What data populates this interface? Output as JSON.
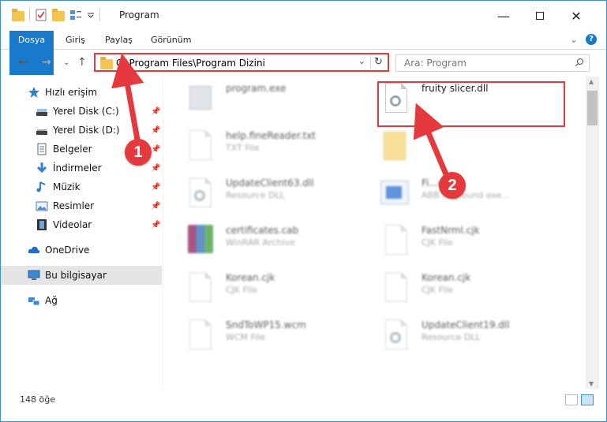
{
  "window": {
    "title": "Program",
    "minimize_glyph": "—",
    "close_glyph": "✕"
  },
  "ribbon": {
    "tabs": [
      "Dosya",
      "Giriş",
      "Paylaş",
      "Görünüm"
    ],
    "collapse_glyph": "⌄",
    "help_glyph": "?"
  },
  "nav": {
    "back_glyph": "←",
    "forward_glyph": "→",
    "recent_glyph": "⌄",
    "up_glyph": "↑",
    "address": "C:\\Program Files\\Program Dizini",
    "address_dropdown_glyph": "⌄",
    "refresh_glyph": "↻",
    "search_placeholder": "Ara: Program"
  },
  "sidebar": {
    "items": [
      {
        "label": "Hızlı erişim",
        "icon": "star-icon",
        "pinned": false
      },
      {
        "label": "Yerel Disk (C:)",
        "icon": "drive-icon",
        "pinned": true
      },
      {
        "label": "Yerel Disk (D:)",
        "icon": "drive-icon",
        "pinned": true
      },
      {
        "label": "Belgeler",
        "icon": "documents-icon",
        "pinned": true
      },
      {
        "label": "İndirmeler",
        "icon": "download-icon",
        "pinned": true
      },
      {
        "label": "Müzik",
        "icon": "music-icon",
        "pinned": true
      },
      {
        "label": "Resimler",
        "icon": "pictures-icon",
        "pinned": true
      },
      {
        "label": "Videolar",
        "icon": "videos-icon",
        "pinned": true
      },
      {
        "label": "OneDrive",
        "icon": "cloud-icon",
        "pinned": false
      },
      {
        "label": "Bu bilgisayar",
        "icon": "computer-icon",
        "pinned": false
      },
      {
        "label": "Ağ",
        "icon": "network-icon",
        "pinned": false
      }
    ],
    "pin_glyph": "📌"
  },
  "files": [
    {
      "name": "program.exe",
      "type": "",
      "icon": "exe-icon"
    },
    {
      "name": "fruity slicer.dll",
      "type": "",
      "icon": "dll-gear-icon"
    },
    {
      "name": "help.fineReader.txt",
      "type": "TXT File",
      "icon": "text-file-icon"
    },
    {
      "name": "",
      "type": "",
      "icon": "folder-icon"
    },
    {
      "name": "UpdateClient63.dll",
      "type": "Resource DLL",
      "icon": "dll-gear-icon"
    },
    {
      "name": "Fi...exe",
      "type": "ABB...kground exe...",
      "icon": "app-icon"
    },
    {
      "name": "certificates.cab",
      "type": "WinRAR Archive",
      "icon": "rar-icon"
    },
    {
      "name": "FastNrml.cjk",
      "type": "CJK File",
      "icon": "text-file-icon"
    },
    {
      "name": "Korean.cjk",
      "type": "CJK File",
      "icon": "text-file-icon"
    },
    {
      "name": "Korean.cjk",
      "type": "CJK File",
      "icon": "text-file-icon"
    },
    {
      "name": "SndToWP15.wcm",
      "type": "WCM File",
      "icon": "text-file-icon"
    },
    {
      "name": "UpdateClient19.dll",
      "type": "Resource DLL",
      "icon": "dll-gear-icon"
    }
  ],
  "annotations": {
    "marker1": "1",
    "marker2": "2",
    "accent_color": "#e5393d"
  },
  "status": {
    "item_count": "148 öğe"
  }
}
